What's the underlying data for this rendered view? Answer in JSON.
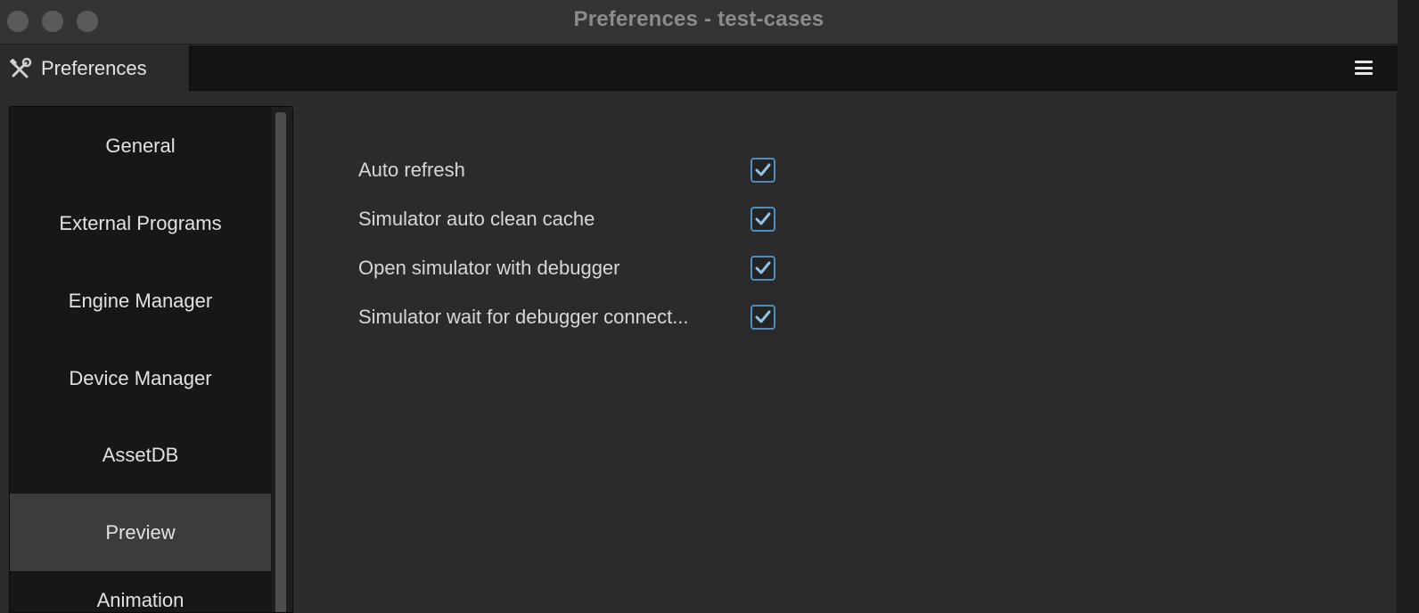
{
  "window": {
    "title": "Preferences - test-cases"
  },
  "tab": {
    "label": "Preferences",
    "icon": "tools-icon"
  },
  "menu": {
    "icon": "hamburger-menu-icon"
  },
  "sidebar": {
    "items": [
      {
        "label": "General",
        "active": false
      },
      {
        "label": "External Programs",
        "active": false
      },
      {
        "label": "Engine Manager",
        "active": false
      },
      {
        "label": "Device Manager",
        "active": false
      },
      {
        "label": "AssetDB",
        "active": false
      },
      {
        "label": "Preview",
        "active": true
      },
      {
        "label": "Animation",
        "active": false
      }
    ]
  },
  "preview": {
    "options": [
      {
        "label": "Auto refresh",
        "checked": true
      },
      {
        "label": "Simulator auto clean cache",
        "checked": true
      },
      {
        "label": "Open simulator with debugger",
        "checked": true
      },
      {
        "label": "Simulator wait for debugger connect...",
        "checked": true
      }
    ]
  },
  "colors": {
    "accent": "#4d8fbf",
    "active_item": "#3c3c3c"
  }
}
